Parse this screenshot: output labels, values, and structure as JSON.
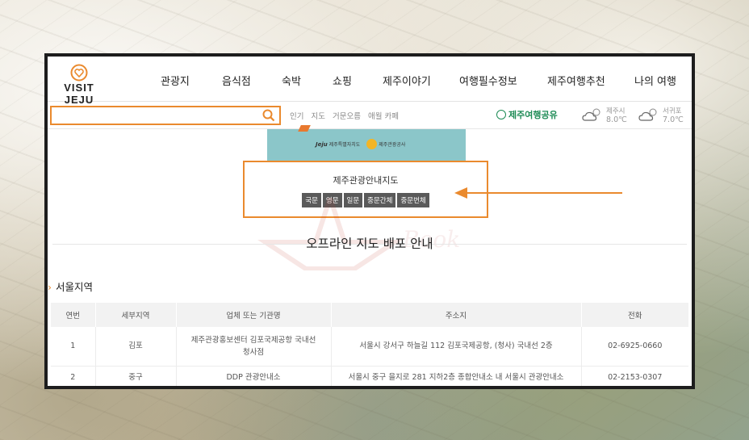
{
  "brand": {
    "logo_text": "VISIT JEJU",
    "accent_color": "#ea8a2e",
    "green_color": "#1d8b55"
  },
  "nav": {
    "items": [
      {
        "label": "관광지"
      },
      {
        "label": "음식점"
      },
      {
        "label": "숙박"
      },
      {
        "label": "쇼핑"
      },
      {
        "label": "제주이야기"
      },
      {
        "label": "여행필수정보"
      },
      {
        "label": "제주여행추천"
      },
      {
        "label": "나의 여행"
      }
    ]
  },
  "search": {
    "placeholder": "",
    "icon": "search-icon",
    "hot_words": [
      "인기",
      "지도",
      "거문오름",
      "애월 카페"
    ]
  },
  "share_label": "제주여행공유",
  "weather": [
    {
      "city": "제주시",
      "temp": "8.0℃",
      "icon": "cloudy-sun-icon"
    },
    {
      "city": "서귀포",
      "temp": "7.0℃",
      "icon": "cloudy-sun-icon"
    }
  ],
  "banner": {
    "text1": "Jeju",
    "text2": "제주특별자치도",
    "text3": "제주관광공사"
  },
  "map_guide": {
    "title": "제주관광안내지도",
    "languages": [
      "국문",
      "영문",
      "일문",
      "중문간체",
      "중문번체"
    ]
  },
  "watermark_text": "Book",
  "section_title": "오프라인 지도 배포 안내",
  "region_title": "서울지역",
  "table": {
    "headers": [
      "연번",
      "세부지역",
      "업체 또는 기관명",
      "주소지",
      "전화"
    ],
    "rows": [
      [
        "1",
        "김포",
        "제주관광홍보센터 김포국제공항 국내선청사점",
        "서울시 강서구 하늘길 112 김포국제공항, (청사) 국내선 2층",
        "02-6925-0660"
      ],
      [
        "2",
        "중구",
        "DDP 관광안내소",
        "서울시 중구 을지로 281 지하2층 종합안내소 내 서울시 관광안내소",
        "02-2153-0307"
      ]
    ]
  }
}
